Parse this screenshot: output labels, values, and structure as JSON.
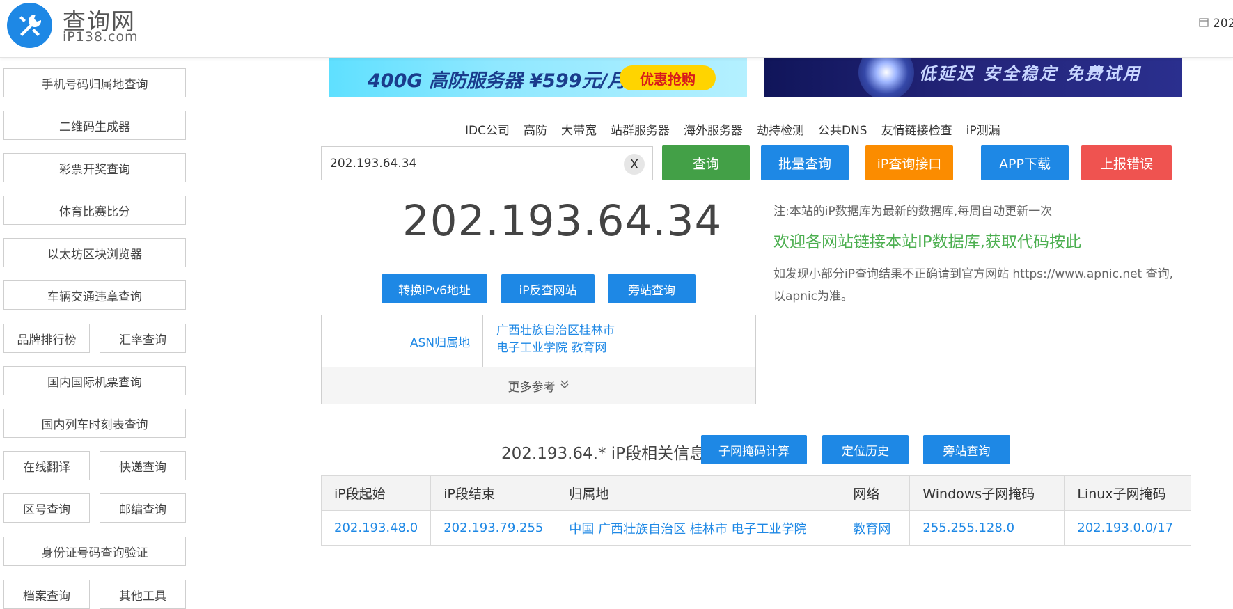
{
  "header": {
    "logo_title": "查询网",
    "logo_sub": "iP138.com",
    "date_prefix": "202"
  },
  "sidebar": {
    "items": [
      "手机号码归属地查询",
      "二维码生成器",
      "彩票开奖查询",
      "体育比赛比分",
      "以太坊区块浏览器",
      "车辆交通违章查询",
      "品牌排行榜",
      "汇率查询",
      "国内国际机票查询",
      "国内列车时刻表查询",
      "在线翻译",
      "快递查询",
      "区号查询",
      "邮编查询",
      "身份证号码查询验证",
      "档案查询",
      "其他工具"
    ]
  },
  "banners": {
    "b1_text": "400G 高防服务器 ¥599元/月",
    "b1_button": "优惠抢购",
    "b2_text": "低延迟  安全稳定  免费试用"
  },
  "nav": [
    "IDC公司",
    "高防",
    "大带宽",
    "站群服务器",
    "海外服务器",
    "劫持检测",
    "公共DNS",
    "友情链接检查",
    "iP测漏"
  ],
  "search": {
    "value": "202.193.64.34",
    "clear_label": "X",
    "query_btn": "查询",
    "batch_btn": "批量查询",
    "api_btn": "iP查询接口",
    "app_btn": "APP下载",
    "report_btn": "上报错误"
  },
  "result": {
    "ip": "202.193.64.34",
    "btn_ipv6": "转换iPv6地址",
    "btn_reverse": "iP反查网站",
    "btn_side": "旁站查询"
  },
  "notes": {
    "line1": "注:本站的iP数据库为最新的数据库,每周自动更新一次",
    "line2": "欢迎各网站链接本站IP数据库,获取代码按此",
    "line3": "如发现小部分iP查询结果不正确请到官方网站 https://www.apnic.net 查询,以apnic为准。"
  },
  "asn": {
    "label": "ASN归属地",
    "value_line1": "广西壮族自治区桂林市",
    "value_line2": "电子工业学院 教育网",
    "more": "更多参考"
  },
  "segment": {
    "title": "202.193.64.* iP段相关信息",
    "btn_subnet": "子网掩码计算",
    "btn_history": "定位历史",
    "btn_side": "旁站查询",
    "headers": [
      "iP段起始",
      "iP段结束",
      "归属地",
      "网络",
      "Windows子网掩码",
      "Linux子网掩码"
    ],
    "row": [
      "202.193.48.0",
      "202.193.79.255",
      "中国 广西壮族自治区 桂林市 电子工业学院",
      "教育网",
      "255.255.128.0",
      "202.193.0.0/17"
    ]
  },
  "colors": {
    "blue": "#1e88e5",
    "green": "#43a047",
    "orange": "#fb8c00",
    "red": "#ef5350"
  }
}
